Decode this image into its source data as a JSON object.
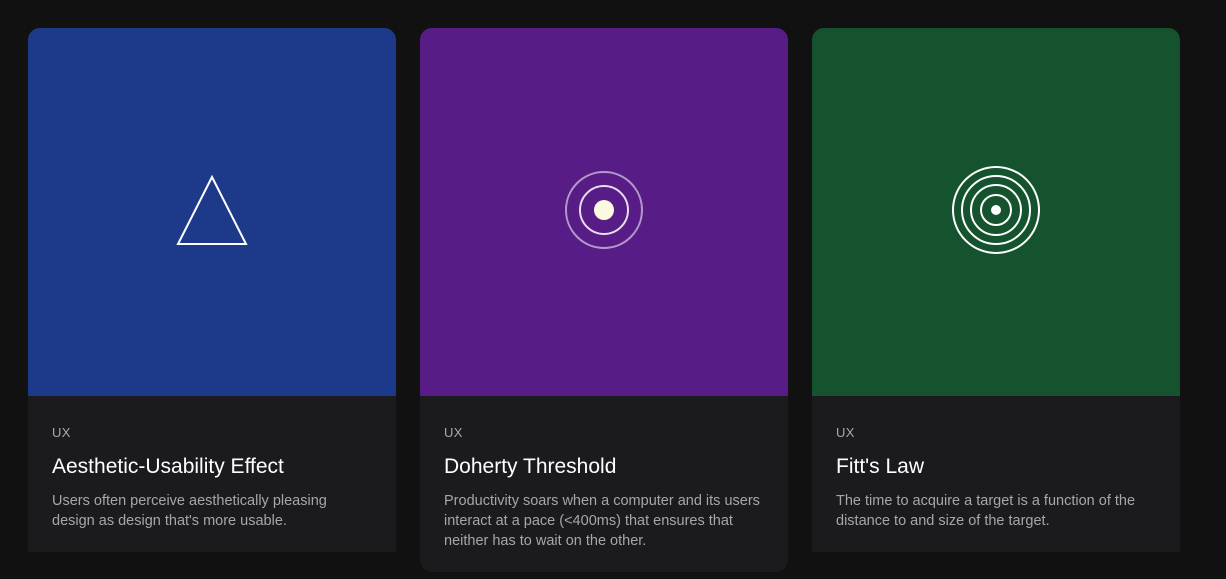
{
  "cards": [
    {
      "tag": "UX",
      "title": "Aesthetic-Usability Effect",
      "description": "Users often perceive aesthetically pleasing design as design that's more usable.",
      "color": "#1d3a8a",
      "icon": "triangle-icon"
    },
    {
      "tag": "UX",
      "title": "Doherty Threshold",
      "description": "Productivity soars when a computer and its users interact at a pace (<400ms) that ensures that neither has to wait on the other.",
      "color": "#581c87",
      "icon": "pulse-rings-icon"
    },
    {
      "tag": "UX",
      "title": "Fitt's Law",
      "description": "The time to acquire a target is a function of the distance to and size of the target.",
      "color": "#14532d",
      "icon": "target-icon"
    }
  ]
}
